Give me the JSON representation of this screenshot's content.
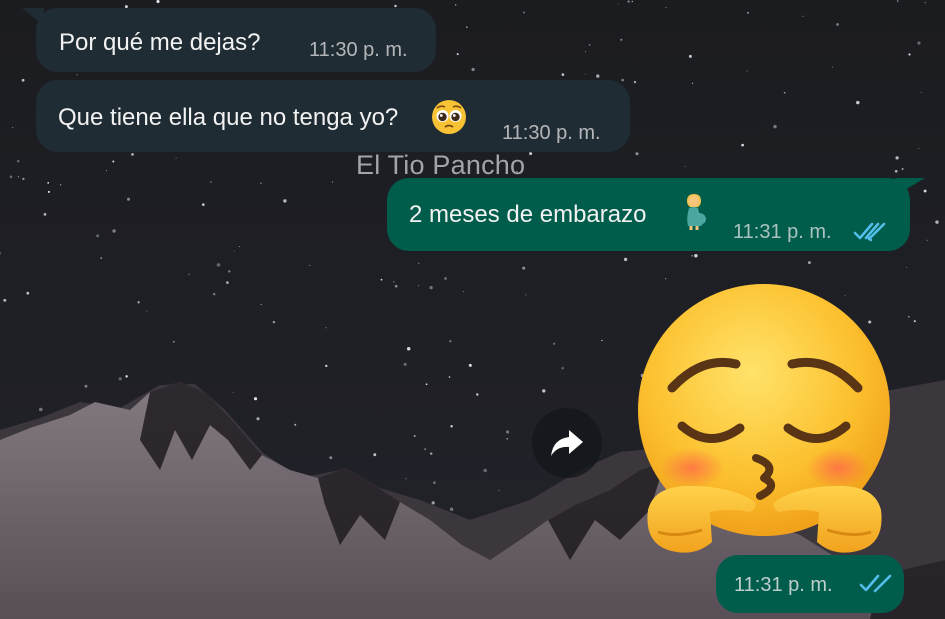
{
  "messages": [
    {
      "direction": "incoming",
      "text": "Por qué me dejas?",
      "time": "11:30 p. m."
    },
    {
      "direction": "incoming",
      "text": "Que tiene ella que no tenga yo?",
      "emoji": "pleading-face",
      "time": "11:30 p. m."
    },
    {
      "direction": "outgoing",
      "text": "2 meses de embarazo",
      "emoji": "pregnant-woman",
      "time": "11:31 p. m.",
      "status": "read"
    },
    {
      "direction": "outgoing",
      "sticker": "pensive-kissing-finger-tap-emoji",
      "time": "11:31 p. m.",
      "status": "read"
    }
  ],
  "watermark": "El Tio Pancho",
  "icons": {
    "read_receipt": "double-check-icon",
    "forward": "forward-arrow-icon"
  },
  "colors": {
    "incoming_bubble": "#202c33",
    "outgoing_bubble": "#005c4b",
    "read_ticks": "#53bdeb",
    "wallpaper_sky": "#1c1d21"
  }
}
